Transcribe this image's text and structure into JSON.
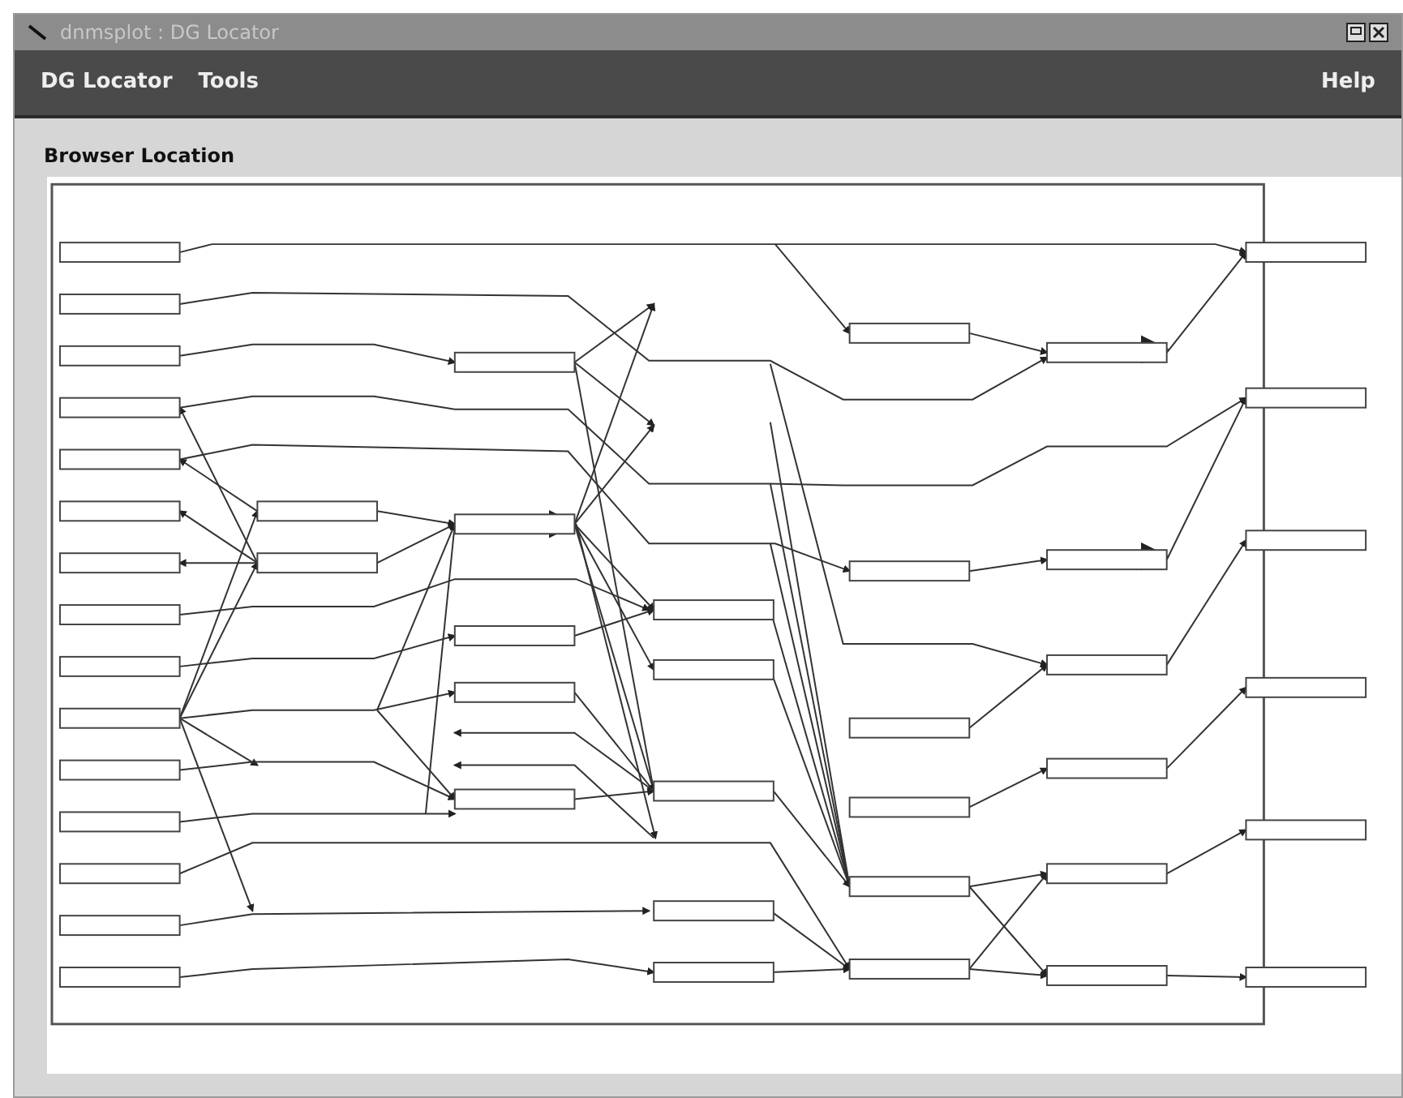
{
  "window": {
    "title": "dnmsplot : DG Locator"
  },
  "menu": {
    "items": [
      "DG Locator",
      "Tools"
    ],
    "help": "Help"
  },
  "panel": {
    "title": "Browser Location"
  }
}
